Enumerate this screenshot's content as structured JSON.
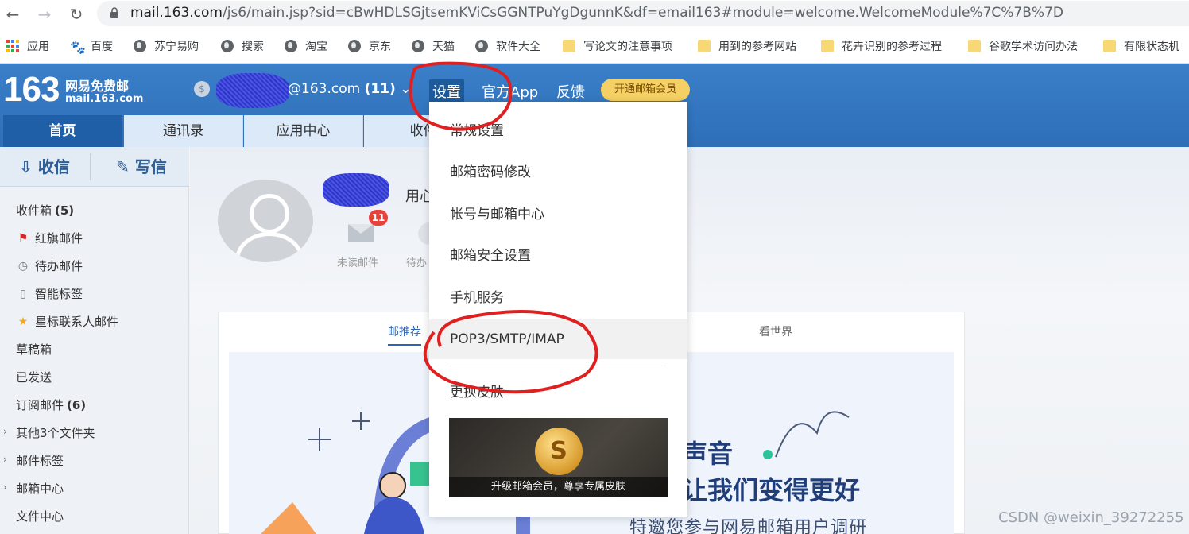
{
  "browser": {
    "url_host": "mail.163.com",
    "url_rest": "/js6/main.jsp?sid=cBwHDLSGjtsemKViCsGGNTPuYgDgunnK&df=email163#module=welcome.WelcomeModule%7C%7B%7D",
    "bookmarks": [
      "应用",
      "百度",
      "苏宁易购",
      "搜索",
      "淘宝",
      "京东",
      "天猫",
      "软件大全",
      "写论文的注意事项",
      "用到的参考网站",
      "花卉识别的参考过程",
      "谷歌学术访问办法",
      "有限状态机"
    ]
  },
  "header": {
    "logo_number": "163",
    "logo_line1": "网易免费邮",
    "logo_line2": "mail.163.com",
    "email_suffix": "@163.com",
    "unread_count": "(11)",
    "menu": [
      "设置",
      "官方App",
      "反馈"
    ],
    "vip_label": "开通邮箱会员"
  },
  "tabs": [
    "首页",
    "通讯录",
    "应用中心",
    "收件"
  ],
  "sidebar": {
    "receive_label": "收信",
    "compose_label": "写信",
    "folders": [
      {
        "label": "收件箱",
        "count": "(5)"
      },
      {
        "label": "红旗邮件"
      },
      {
        "label": "待办邮件"
      },
      {
        "label": "智能标签"
      },
      {
        "label": "星标联系人邮件"
      },
      {
        "label": "草稿箱"
      },
      {
        "label": "已发送"
      },
      {
        "label": "订阅邮件",
        "count": "(6)"
      },
      {
        "label": "其他3个文件夹"
      },
      {
        "label": "邮件标签"
      },
      {
        "label": "邮箱中心"
      },
      {
        "label": "文件中心"
      }
    ]
  },
  "welcome": {
    "greeting": "用心",
    "unread_badge": "11",
    "unread_label": "未读邮件",
    "todo_label": "待办",
    "card_tabs": [
      "邮推荐",
      "看世界"
    ],
    "banner_line1": "声音",
    "banner_line2": "让我们变得更好",
    "banner_line3": "特邀您参与网易邮箱用户调研"
  },
  "settings_menu": {
    "items": [
      "常规设置",
      "邮箱密码修改",
      "帐号与邮箱中心",
      "邮箱安全设置",
      "手机服务",
      "POP3/SMTP/IMAP",
      "更换皮肤"
    ],
    "promo_caption": "升级邮箱会员，尊享专属皮肤"
  },
  "watermark": "CSDN @weixin_39272255"
}
